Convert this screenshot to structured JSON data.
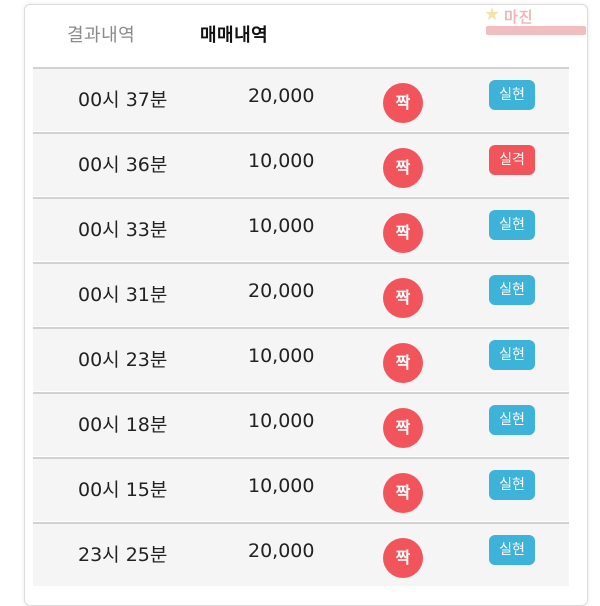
{
  "tabs": {
    "results_label": "결과내역",
    "trades_label": "매매내역"
  },
  "rows": [
    {
      "time": "00시 37분",
      "amount": "20,000",
      "pick": "짝",
      "result": "실현"
    },
    {
      "time": "00시 36분",
      "amount": "10,000",
      "pick": "짝",
      "result": "실격"
    },
    {
      "time": "00시 33분",
      "amount": "10,000",
      "pick": "짝",
      "result": "실현"
    },
    {
      "time": "00시 31분",
      "amount": "20,000",
      "pick": "짝",
      "result": "실현"
    },
    {
      "time": "00시 23분",
      "amount": "10,000",
      "pick": "짝",
      "result": "실현"
    },
    {
      "time": "00시 18분",
      "amount": "10,000",
      "pick": "짝",
      "result": "실현"
    },
    {
      "time": "00시 15분",
      "amount": "10,000",
      "pick": "짝",
      "result": "실현"
    },
    {
      "time": "23시 25분",
      "amount": "20,000",
      "pick": "짝",
      "result": "실현"
    }
  ],
  "colors": {
    "pick_circle": "#f2545b",
    "result_win": "#3db3d9",
    "result_lose": "#f2545b"
  },
  "watermark": {
    "title": "마진"
  }
}
